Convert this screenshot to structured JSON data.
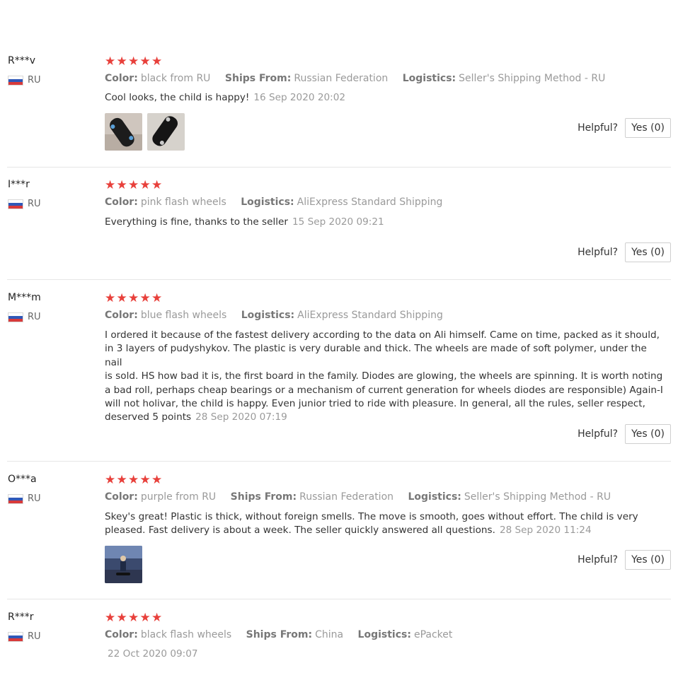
{
  "helpful_label": "Helpful?",
  "reviews": [
    {
      "user": "R***v",
      "country": "RU",
      "rating": 5,
      "meta": [
        {
          "k": "Color:",
          "v": "black from RU"
        },
        {
          "k": "Ships From:",
          "v": "Russian Federation"
        },
        {
          "k": "Logistics:",
          "v": "Seller's Shipping Method - RU"
        }
      ],
      "text": "Cool looks, the child is happy!",
      "date": "16 Sep 2020 20:02",
      "photos": [
        "skateboard-photo",
        "skateboard-photo"
      ],
      "helpful_btn": "Yes (0)"
    },
    {
      "user": "I***r",
      "country": "RU",
      "rating": 5,
      "meta": [
        {
          "k": "Color:",
          "v": "pink flash wheels"
        },
        {
          "k": "Logistics:",
          "v": "AliExpress Standard Shipping"
        }
      ],
      "text": "Everything is fine, thanks to the seller",
      "date": "15 Sep 2020 09:21",
      "photos": [],
      "helpful_btn": "Yes (0)"
    },
    {
      "user": "M***m",
      "country": "RU",
      "rating": 5,
      "meta": [
        {
          "k": "Color:",
          "v": "blue flash wheels"
        },
        {
          "k": "Logistics:",
          "v": "AliExpress Standard Shipping"
        }
      ],
      "text_lines": [
        "I ordered it because of the fastest delivery according to the data on Ali himself. Came on time, packed as it should,",
        "in 3 layers of pudyshykov. The plastic is very durable and thick. The wheels are made of soft polymer, under the nail",
        "is sold. HS how bad it is, the first board in the family. Diodes are glowing, the wheels are spinning. It is worth noting",
        "a bad roll, perhaps cheap bearings or a mechanism of current generation for wheels diodes are responsible) Again-I",
        "will not holivar, the child is happy. Even junior tried to ride with pleasure. In general, all the rules, seller respect,",
        "deserved 5 points"
      ],
      "date": "28 Sep 2020 07:19",
      "photos": [],
      "helpful_btn": "Yes (0)"
    },
    {
      "user": "O***a",
      "country": "RU",
      "rating": 5,
      "meta": [
        {
          "k": "Color:",
          "v": "purple from RU"
        },
        {
          "k": "Ships From:",
          "v": "Russian Federation"
        },
        {
          "k": "Logistics:",
          "v": "Seller's Shipping Method - RU"
        }
      ],
      "text_lines": [
        "Skey's great! Plastic is thick, without foreign smells. The move is smooth, goes without effort. The child is very",
        "pleased. Fast delivery is about a week. The seller quickly answered all questions."
      ],
      "date": "28 Sep 2020 11:24",
      "photos": [
        "rider-photo"
      ],
      "helpful_btn": "Yes (0)"
    },
    {
      "user": "R***r",
      "country": "RU",
      "rating": 5,
      "meta": [
        {
          "k": "Color:",
          "v": "black flash wheels"
        },
        {
          "k": "Ships From:",
          "v": "China"
        },
        {
          "k": "Logistics:",
          "v": "ePacket"
        }
      ],
      "date": "22 Oct 2020 09:07"
    }
  ]
}
